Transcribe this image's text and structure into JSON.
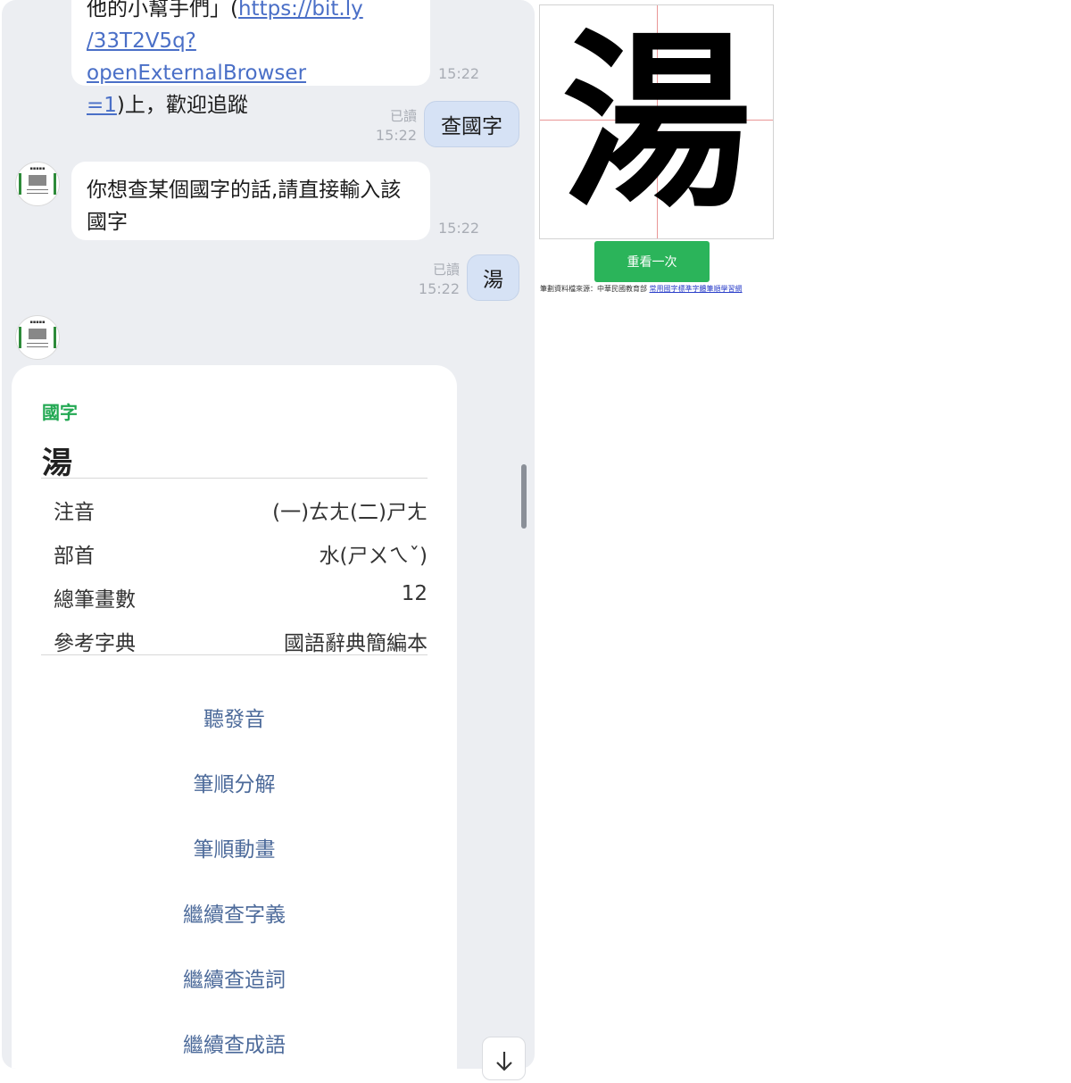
{
  "chat": {
    "msg1": {
      "line1_prefix": "他的小幫手們」(",
      "line1_link": "https://bit.ly",
      "line2_link": "/33T2V5q?openExternalBrowser",
      "line3_link": "=1",
      "line3_suffix": ")上，歡迎追蹤",
      "time": "15:22"
    },
    "out1": {
      "text": "查國字",
      "read": "已讀",
      "time": "15:22"
    },
    "in2": {
      "text": "你想查某個國字的話,請直接輸入該國字",
      "time": "15:22"
    },
    "out2": {
      "text": "湯",
      "read": "已讀",
      "time": "15:22"
    }
  },
  "card": {
    "tag": "國字",
    "character": "湯",
    "rows": [
      {
        "key": "注音",
        "value": "(一)ㄊㄤ(二)ㄕㄤ"
      },
      {
        "key": "部首",
        "value": "水(ㄕㄨㄟˇ)"
      },
      {
        "key": "總筆畫數",
        "value": "12"
      },
      {
        "key": "參考字典",
        "value": "國語辭典簡編本"
      }
    ],
    "actions": [
      "聽發音",
      "筆順分解",
      "筆順動畫",
      "繼續查字義",
      "繼續查造詞",
      "繼續查成語"
    ]
  },
  "stroke_panel": {
    "character": "湯",
    "replay_label": "重看一次",
    "source_prefix": "筆劃資料檔來源：中華民國教育部 ",
    "source_link": "常用國字標準字體筆順學習網"
  },
  "colors": {
    "accent_green": "#22a852",
    "action_blue": "#4c6a9a",
    "link_blue": "#4a6fc7",
    "outgoing_bubble": "#d6e2f5",
    "chat_bg": "#eceef2"
  },
  "icons": {
    "scroll_down": "arrow-down-icon",
    "avatar": "bot-avatar"
  }
}
